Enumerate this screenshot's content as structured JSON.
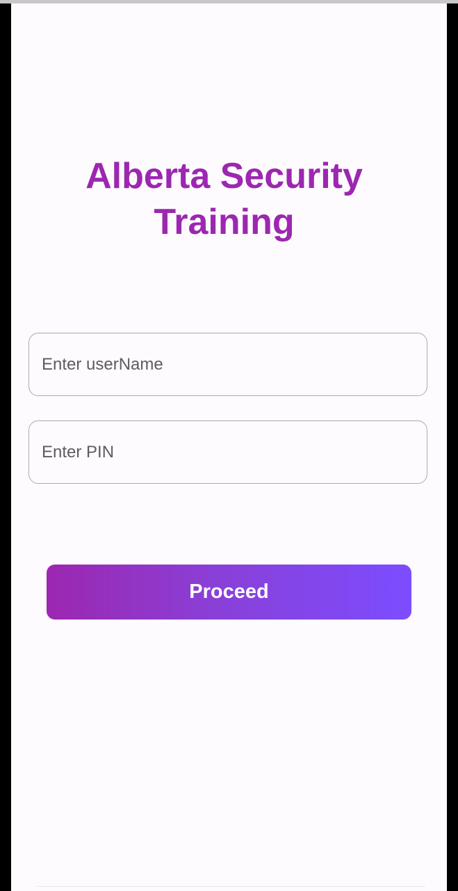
{
  "app": {
    "title_line1": "Alberta Security",
    "title_line2": "Training"
  },
  "form": {
    "username": {
      "value": "",
      "placeholder": "Enter userName"
    },
    "pin": {
      "value": "",
      "placeholder": "Enter PIN"
    },
    "proceed_label": "Proceed"
  },
  "colors": {
    "accent": "#9c27b0",
    "gradient_start": "#9c27b0",
    "gradient_end": "#7c4dff",
    "background": "#fdfbfe"
  }
}
